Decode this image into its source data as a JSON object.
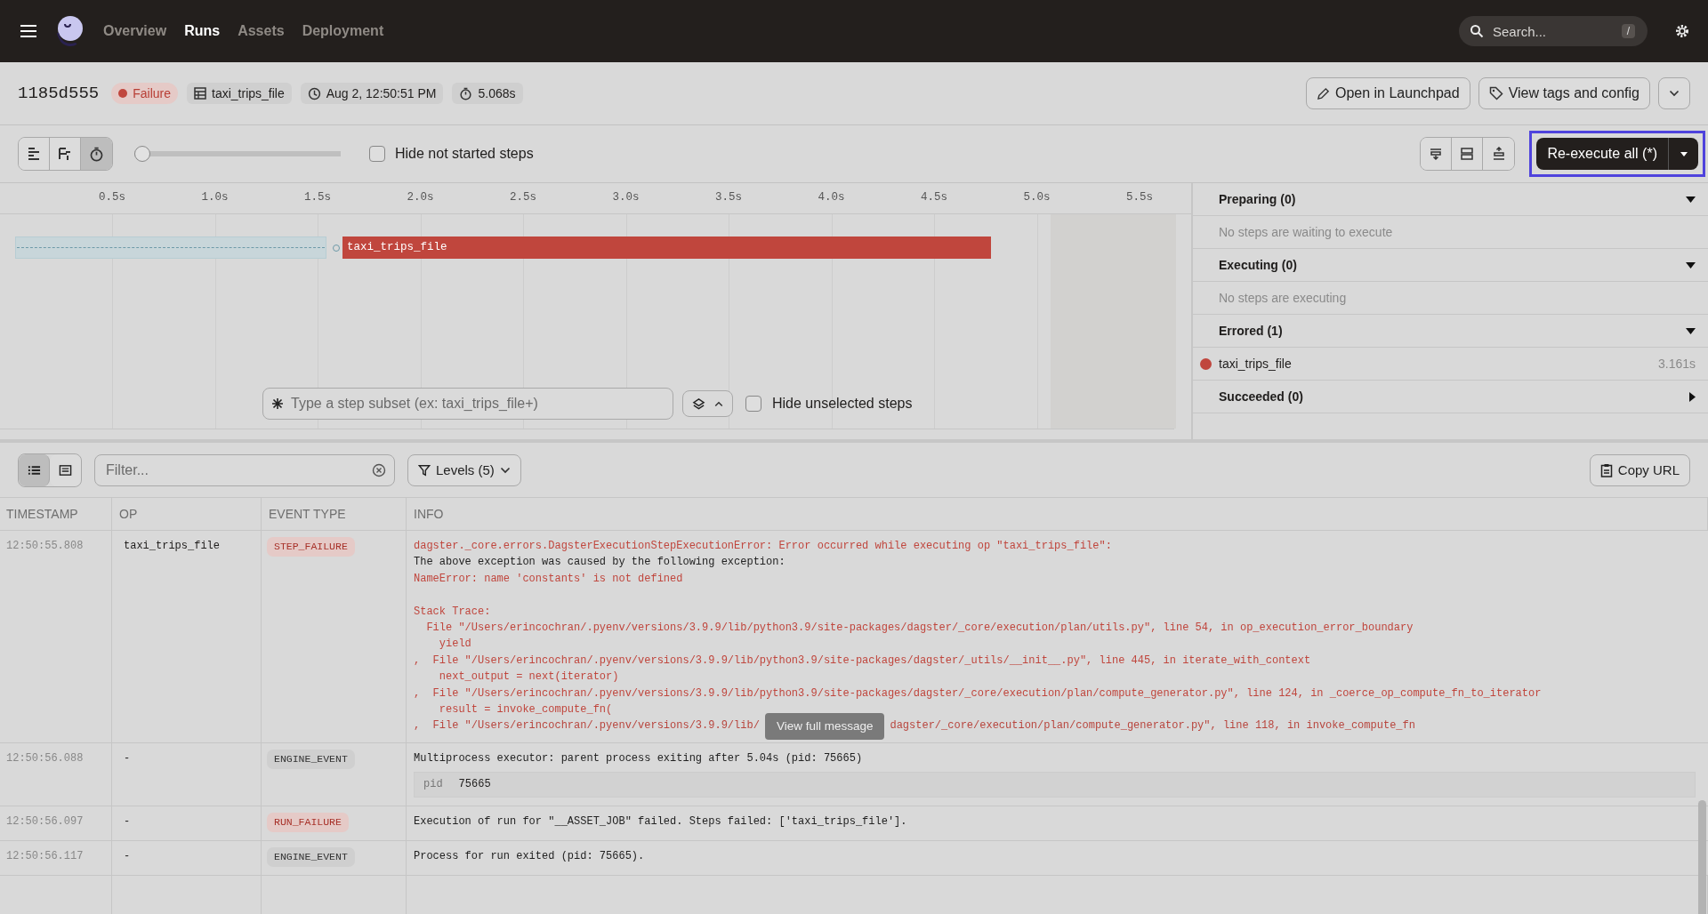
{
  "nav": {
    "items": [
      {
        "label": "Overview",
        "selected": false
      },
      {
        "label": "Runs",
        "selected": true
      },
      {
        "label": "Assets",
        "selected": false
      },
      {
        "label": "Deployment",
        "selected": false
      }
    ],
    "search": {
      "placeholder": "Search...",
      "shortcut": "/"
    }
  },
  "run": {
    "id": "1185d555",
    "status": "Failure",
    "job": "taxi_trips_file",
    "started": "Aug 2, 12:50:51 PM",
    "duration": "5.068s",
    "actions": [
      "Open in Launchpad",
      "View tags and config"
    ]
  },
  "toolbar": {
    "views": [
      {
        "kind": "flat",
        "selected": false
      },
      {
        "kind": "tree",
        "selected": false
      },
      {
        "kind": "timer",
        "selected": true
      }
    ],
    "zoom": {
      "level": 0.0
    },
    "hide_not_started": {
      "label": "Hide not started steps",
      "checked": false
    },
    "layout_buttons": [
      {
        "kind": "expand"
      },
      {
        "kind": "split"
      },
      {
        "kind": "collapse"
      }
    ],
    "reexecute": {
      "label": "Re-execute all (*)",
      "highlighted": true
    }
  },
  "timeline": {
    "ticks": [
      "0.5s",
      "1.0s",
      "1.5s",
      "2.0s",
      "2.5s",
      "3.0s",
      "3.5s",
      "4.0s",
      "4.5s",
      "5.0s",
      "5.5s"
    ],
    "steps": [
      {
        "name": "taxi_trips_file",
        "color": "#c0463d"
      }
    ],
    "subset": {
      "placeholder": "Type a step subset (ex: taxi_trips_file+)"
    },
    "hide_unselected": {
      "label": "Hide unselected steps",
      "checked": false
    }
  },
  "step_panel": [
    {
      "title": "Preparing (0)",
      "expanded": true,
      "empty_text": "No steps are waiting to execute"
    },
    {
      "title": "Executing (0)",
      "expanded": true,
      "empty_text": "No steps are executing"
    },
    {
      "title": "Errored (1)",
      "expanded": true,
      "steps": [
        {
          "name": "taxi_trips_file",
          "duration": "3.161s",
          "color": "#c0463d"
        }
      ]
    },
    {
      "title": "Succeeded (0)",
      "expanded": false
    }
  ],
  "log_toolbar": {
    "views": [
      {
        "kind": "list",
        "selected": true
      },
      {
        "kind": "raw",
        "selected": false
      }
    ],
    "filter": {
      "placeholder": "Filter..."
    },
    "levels": "Levels (5)",
    "copy_url": "Copy URL"
  },
  "log_table": {
    "columns": [
      "TIMESTAMP",
      "OP",
      "EVENT TYPE",
      "INFO"
    ],
    "rows": [
      {
        "timestamp": "12:50:55.808",
        "op": "taxi_trips_file",
        "event_type": "STEP_FAILURE",
        "kind": "error",
        "lines": [
          {
            "kind": "error",
            "text": "dagster._core.errors.DagsterExecutionStepExecutionError: Error occurred while executing op \"taxi_trips_file\":"
          },
          {
            "kind": "plain",
            "text": "The above exception was caused by the following exception:"
          },
          {
            "kind": "error",
            "text": "NameError: name 'constants' is not defined"
          },
          {
            "kind": "blank"
          },
          {
            "kind": "error",
            "text": "Stack Trace:"
          },
          {
            "kind": "error",
            "text": "  File \"/Users/erincochran/.pyenv/versions/3.9.9/lib/python3.9/site-packages/dagster/_core/execution/plan/utils.py\", line 54, in op_execution_error_boundary"
          },
          {
            "kind": "error",
            "text": "    yield"
          },
          {
            "kind": "error",
            "text": ",  File \"/Users/erincochran/.pyenv/versions/3.9.9/lib/python3.9/site-packages/dagster/_utils/__init__.py\", line 445, in iterate_with_context"
          },
          {
            "kind": "error",
            "text": "    next_output = next(iterator)"
          },
          {
            "kind": "error",
            "text": ",  File \"/Users/erincochran/.pyenv/versions/3.9.9/lib/python3.9/site-packages/dagster/_core/execution/plan/compute_generator.py\", line 124, in _coerce_op_compute_fn_to_iterator"
          },
          {
            "kind": "error",
            "text": "    result = invoke_compute_fn("
          },
          {
            "kind": "covered",
            "text": ",  File \"/Users/erincochran/.pyenv/versions/3.9.9/lib/",
            "after": "dagster/_core/execution/plan/compute_generator.py\", line 118, in invoke_compute_fn",
            "overlay": "View full message"
          }
        ]
      },
      {
        "timestamp": "12:50:56.088",
        "op": "-",
        "event_type": "ENGINE_EVENT",
        "kind": "info",
        "lines": [
          {
            "kind": "plain",
            "text": "Multiprocess executor: parent process exiting after 5.04s (pid: 75665)"
          }
        ],
        "metadata": [
          {
            "key": "pid",
            "value": "75665"
          }
        ]
      },
      {
        "timestamp": "12:50:56.097",
        "op": "-",
        "event_type": "RUN_FAILURE",
        "kind": "error",
        "lines": [
          {
            "kind": "plain",
            "text": "Execution of run for \"__ASSET_JOB\" failed. Steps failed: ['taxi_trips_file']."
          }
        ]
      },
      {
        "timestamp": "12:50:56.117",
        "op": "-",
        "event_type": "ENGINE_EVENT",
        "kind": "info",
        "lines": [
          {
            "kind": "plain",
            "text": "Process for run exited (pid: 75665)."
          }
        ]
      }
    ]
  }
}
